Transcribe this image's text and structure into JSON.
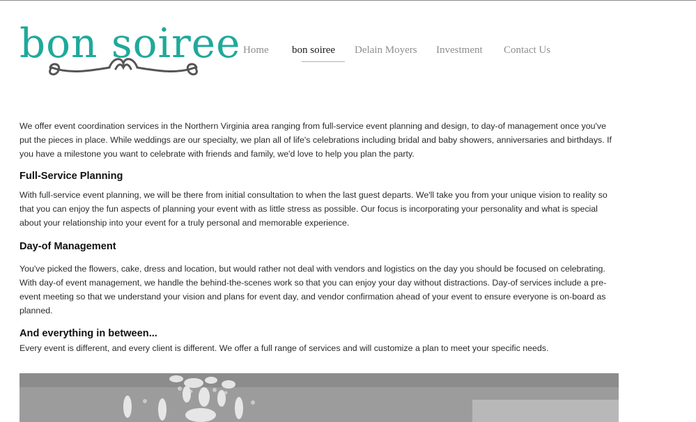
{
  "logo": {
    "text": "bon soiree"
  },
  "nav": [
    {
      "label": "Home",
      "active": false
    },
    {
      "label": "bon soiree",
      "active": true
    },
    {
      "label": "Delain Moyers",
      "active": false
    },
    {
      "label": "Investment",
      "active": false
    },
    {
      "label": "Contact Us",
      "active": false
    }
  ],
  "intro": "We offer event coordination services in the Northern Virginia area ranging from full-service event planning and design, to day-of management once you've put the pieces in place. While weddings are our specialty, we plan all of life's celebrations including bridal and baby showers, anniversaries and birthdays. If you have a milestone you want to celebrate with friends and family, we'd love to help you plan the party.",
  "sections": [
    {
      "heading": "Full-Service Planning",
      "body": "With full-service event planning, we will be there from initial consultation to when the last guest departs. We'll take you from your unique vision to reality so that you can enjoy the fun aspects of planning your event with as little stress as possible. Our focus is incorporating  your personality and what is special about your relationship into your event for a truly personal and memorable experience."
    },
    {
      "heading": "Day-of Management",
      "body": "You've picked the flowers, cake, dress and location, but would rather not deal with vendors and logistics on the day you should be focused on celebrating.  With day-of event management, we handle the behind-the-scenes work so that you can enjoy your day without distractions. Day-of services include a pre-event meeting so that we understand your vision and plans for event day, and vendor confirmation ahead of your event to ensure everyone is on-board as planned."
    },
    {
      "heading": "And everything in between...",
      "body": "Every event is different, and every client is different.  We offer a full range of services and will customize a plan to meet your specific needs."
    }
  ],
  "colors": {
    "brand": "#1fa99a",
    "nav_inactive": "#8e8e8e",
    "nav_active": "#1a1a1a",
    "flourish": "#555555"
  },
  "icons": {
    "flourish": "scroll-flourish-icon",
    "photo": "chandelier-photo"
  }
}
